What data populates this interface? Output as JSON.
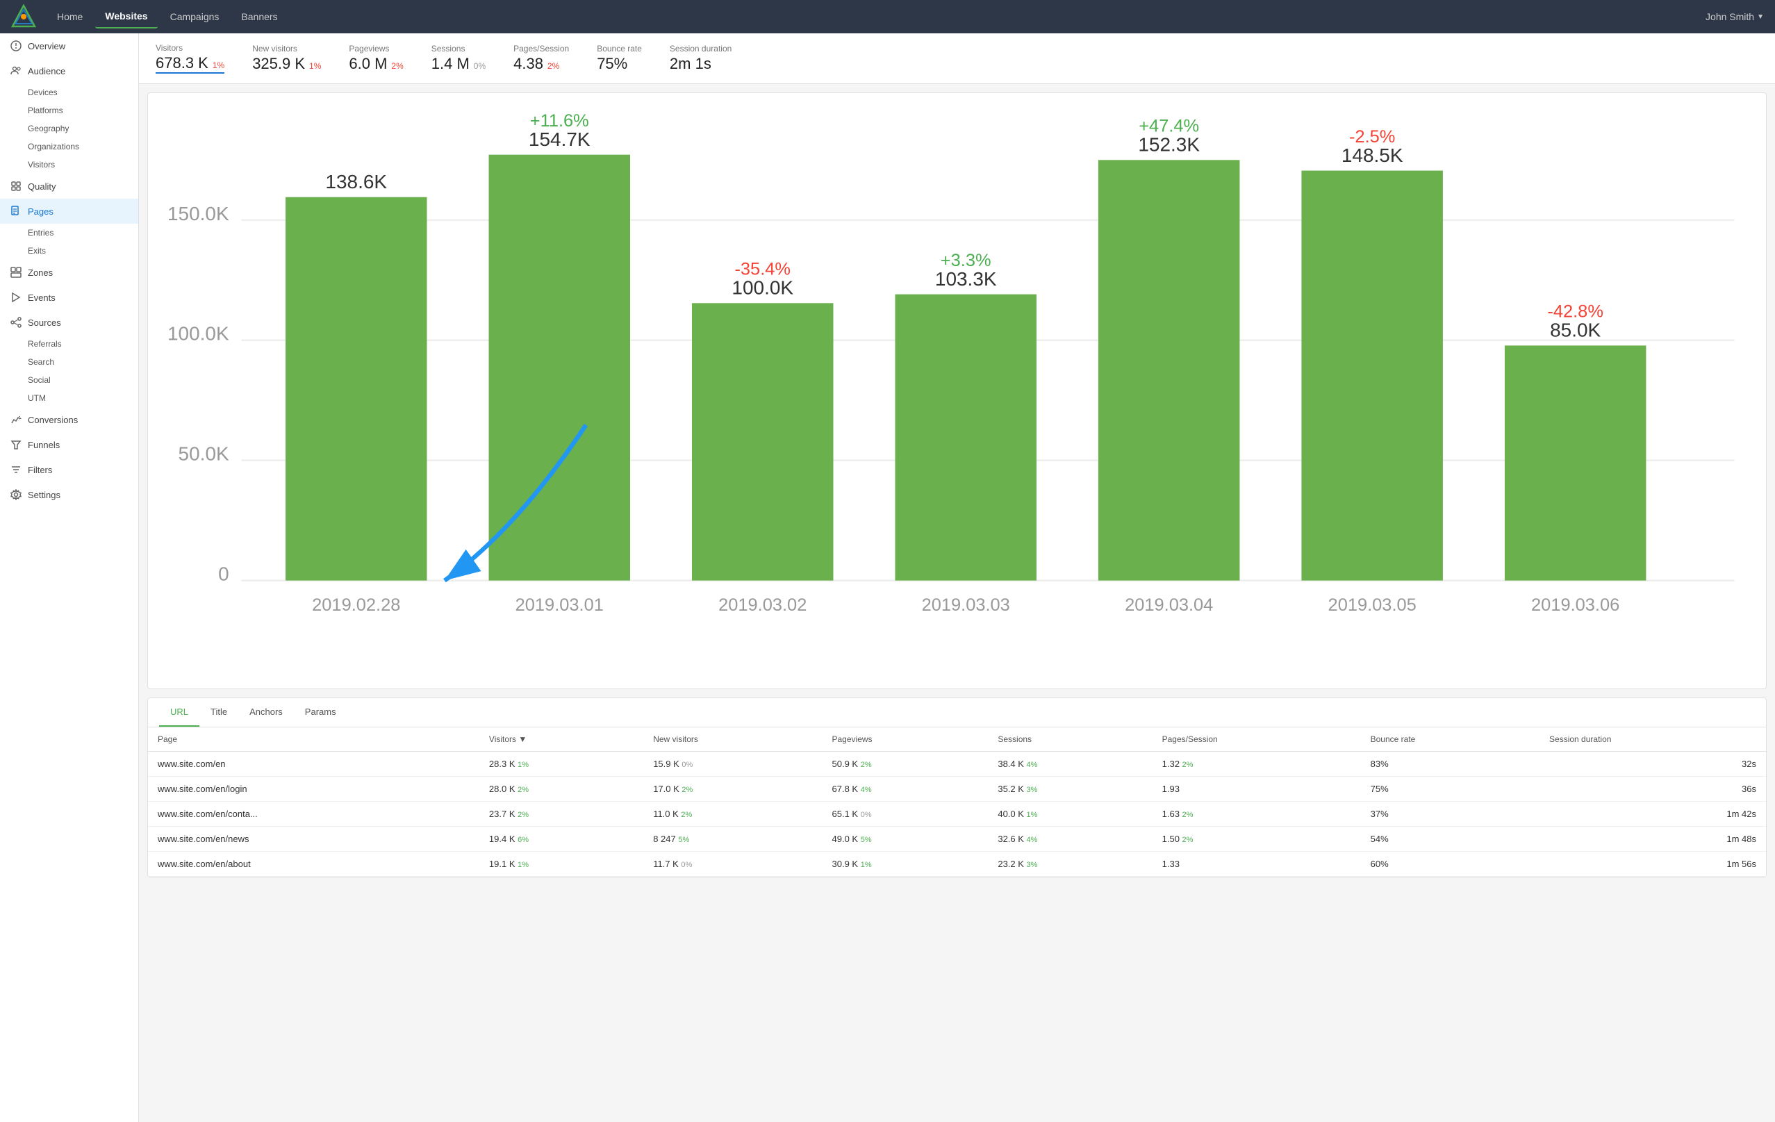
{
  "topnav": {
    "links": [
      {
        "label": "Home",
        "active": false
      },
      {
        "label": "Websites",
        "active": true
      },
      {
        "label": "Campaigns",
        "active": false
      },
      {
        "label": "Banners",
        "active": false
      }
    ],
    "user": "John Smith"
  },
  "sidebar": {
    "items": [
      {
        "label": "Overview",
        "icon": "overview",
        "active": false,
        "sub": []
      },
      {
        "label": "Audience",
        "icon": "audience",
        "active": false,
        "sub": [
          {
            "label": "Devices",
            "active": false
          },
          {
            "label": "Platforms",
            "active": false
          },
          {
            "label": "Geography",
            "active": false
          },
          {
            "label": "Organizations",
            "active": false
          },
          {
            "label": "Visitors",
            "active": false
          }
        ]
      },
      {
        "label": "Quality",
        "icon": "quality",
        "active": false,
        "sub": []
      },
      {
        "label": "Pages",
        "icon": "pages",
        "active": true,
        "sub": [
          {
            "label": "Entries",
            "active": false
          },
          {
            "label": "Exits",
            "active": false
          }
        ]
      },
      {
        "label": "Zones",
        "icon": "zones",
        "active": false,
        "sub": []
      },
      {
        "label": "Events",
        "icon": "events",
        "active": false,
        "sub": []
      },
      {
        "label": "Sources",
        "icon": "sources",
        "active": false,
        "sub": [
          {
            "label": "Referrals",
            "active": false
          },
          {
            "label": "Search",
            "active": false
          },
          {
            "label": "Social",
            "active": false
          },
          {
            "label": "UTM",
            "active": false
          }
        ]
      },
      {
        "label": "Conversions",
        "icon": "conversions",
        "active": false,
        "sub": []
      },
      {
        "label": "Funnels",
        "icon": "funnels",
        "active": false,
        "sub": []
      },
      {
        "label": "Filters",
        "icon": "filters",
        "active": false,
        "sub": []
      },
      {
        "label": "Settings",
        "icon": "settings",
        "active": false,
        "sub": []
      }
    ]
  },
  "stats": [
    {
      "label": "Visitors",
      "value": "678.3 K",
      "change": "1%",
      "changeType": "pos",
      "underline": true
    },
    {
      "label": "New visitors",
      "value": "325.9 K",
      "change": "1%",
      "changeType": "pos"
    },
    {
      "label": "Pageviews",
      "value": "6.0 M",
      "change": "2%",
      "changeType": "pos"
    },
    {
      "label": "Sessions",
      "value": "1.4 M",
      "change": "0%",
      "changeType": "zero"
    },
    {
      "label": "Pages/Session",
      "value": "4.38",
      "change": "2%",
      "changeType": "pos"
    },
    {
      "label": "Bounce rate",
      "value": "75%",
      "change": "",
      "changeType": "none"
    },
    {
      "label": "Session duration",
      "value": "2m 1s",
      "change": "",
      "changeType": "none"
    }
  ],
  "chart": {
    "bars": [
      {
        "date": "2019.02.28",
        "value": 138600,
        "label": "138.6K",
        "change": null,
        "changeType": "none"
      },
      {
        "date": "2019.03.01",
        "value": 154700,
        "label": "154.7K",
        "change": "+11.6%",
        "changeType": "pos"
      },
      {
        "date": "2019.03.02",
        "value": 100000,
        "label": "100.0K",
        "change": "-35.4%",
        "changeType": "neg"
      },
      {
        "date": "2019.03.03",
        "value": 103300,
        "label": "103.3K",
        "change": "+3.3%",
        "changeType": "pos"
      },
      {
        "date": "2019.03.04",
        "value": 152300,
        "label": "152.3K",
        "change": "+47.4%",
        "changeType": "pos"
      },
      {
        "date": "2019.03.05",
        "value": 148500,
        "label": "148.5K",
        "change": "-2.5%",
        "changeType": "neg"
      },
      {
        "date": "2019.03.06",
        "value": 85000,
        "label": "85.0K",
        "change": "-42.8%",
        "changeType": "neg"
      }
    ],
    "yLabels": [
      "0",
      "50.0K",
      "100.0K",
      "150.0K"
    ],
    "maxValue": 160000
  },
  "tableTabs": [
    {
      "label": "URL",
      "active": true
    },
    {
      "label": "Title",
      "active": false
    },
    {
      "label": "Anchors",
      "active": false
    },
    {
      "label": "Params",
      "active": false
    }
  ],
  "tableHeaders": [
    "Page",
    "Visitors ▼",
    "New visitors",
    "Pageviews",
    "Sessions",
    "Pages/Session",
    "Bounce rate",
    "Session duration"
  ],
  "tableRows": [
    {
      "page": "www.site.com/en",
      "visitors": "28.3 K",
      "visitorsChange": "1%",
      "visitorsChangeType": "pos",
      "newVisitors": "15.9 K",
      "newVisitorsChange": "0%",
      "newVisitorsChangeType": "zero",
      "pageviews": "50.9 K",
      "pageviewsChange": "2%",
      "pageviewsChangeType": "pos",
      "sessions": "38.4 K",
      "sessionsChange": "4%",
      "sessionsChangeType": "pos",
      "pagesSession": "1.32",
      "pagesSessionChange": "2%",
      "pagesSessionChangeType": "pos",
      "bounceRate": "83%",
      "sessionDuration": "32s"
    },
    {
      "page": "www.site.com/en/login",
      "visitors": "28.0 K",
      "visitorsChange": "2%",
      "visitorsChangeType": "pos",
      "newVisitors": "17.0 K",
      "newVisitorsChange": "2%",
      "newVisitorsChangeType": "pos",
      "pageviews": "67.8 K",
      "pageviewsChange": "4%",
      "pageviewsChangeType": "pos",
      "sessions": "35.2 K",
      "sessionsChange": "3%",
      "sessionsChangeType": "pos",
      "pagesSession": "1.93",
      "pagesSessionChange": "",
      "pagesSessionChangeType": "none",
      "bounceRate": "75%",
      "sessionDuration": "36s"
    },
    {
      "page": "www.site.com/en/conta...",
      "visitors": "23.7 K",
      "visitorsChange": "2%",
      "visitorsChangeType": "pos",
      "newVisitors": "11.0 K",
      "newVisitorsChange": "2%",
      "newVisitorsChangeType": "pos",
      "pageviews": "65.1 K",
      "pageviewsChange": "0%",
      "pageviewsChangeType": "zero",
      "sessions": "40.0 K",
      "sessionsChange": "1%",
      "sessionsChangeType": "pos",
      "pagesSession": "1.63",
      "pagesSessionChange": "2%",
      "pagesSessionChangeType": "pos",
      "bounceRate": "37%",
      "sessionDuration": "1m 42s"
    },
    {
      "page": "www.site.com/en/news",
      "visitors": "19.4 K",
      "visitorsChange": "6%",
      "visitorsChangeType": "pos",
      "newVisitors": "8 247",
      "newVisitorsChange": "5%",
      "newVisitorsChangeType": "pos",
      "pageviews": "49.0 K",
      "pageviewsChange": "5%",
      "pageviewsChangeType": "pos",
      "sessions": "32.6 K",
      "sessionsChange": "4%",
      "sessionsChangeType": "pos",
      "pagesSession": "1.50",
      "pagesSessionChange": "2%",
      "pagesSessionChangeType": "pos",
      "bounceRate": "54%",
      "sessionDuration": "1m 48s"
    },
    {
      "page": "www.site.com/en/about",
      "visitors": "19.1 K",
      "visitorsChange": "1%",
      "visitorsChangeType": "pos",
      "newVisitors": "11.7 K",
      "newVisitorsChange": "0%",
      "newVisitorsChangeType": "zero",
      "pageviews": "30.9 K",
      "pageviewsChange": "1%",
      "pageviewsChangeType": "pos",
      "sessions": "23.2 K",
      "sessionsChange": "3%",
      "sessionsChangeType": "pos",
      "pagesSession": "1.33",
      "pagesSessionChange": "",
      "pagesSessionChangeType": "none",
      "bounceRate": "60%",
      "sessionDuration": "1m 56s"
    }
  ]
}
